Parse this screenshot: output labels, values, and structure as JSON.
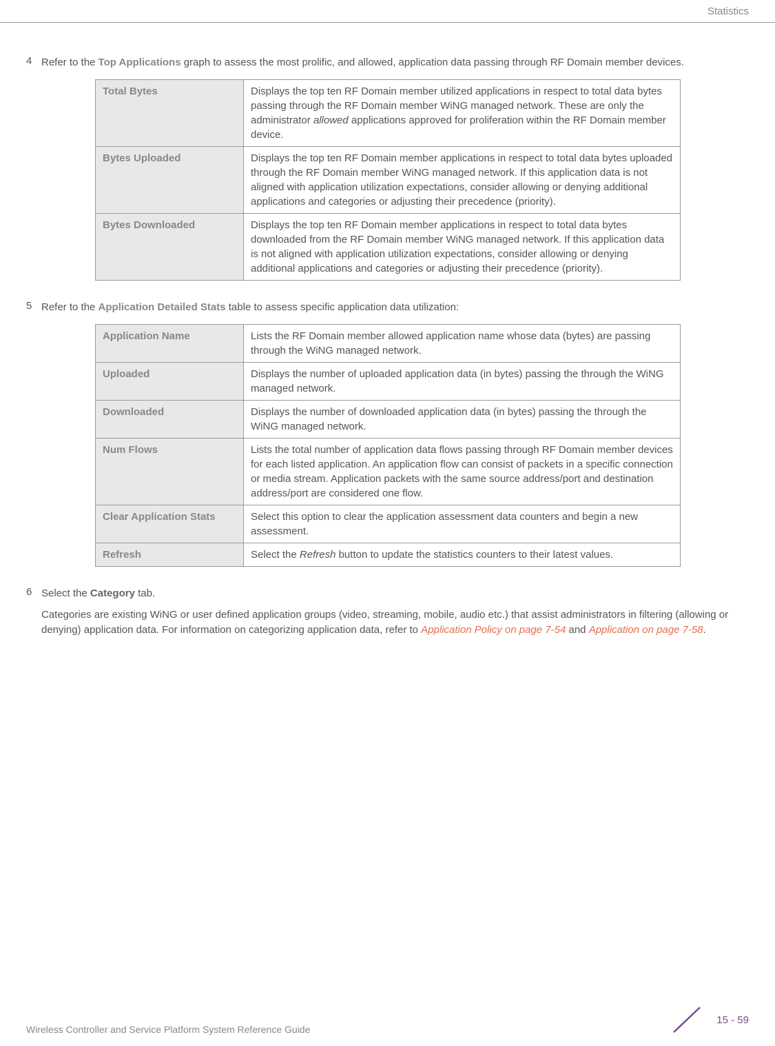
{
  "header": {
    "section": "Statistics"
  },
  "steps": {
    "s4": {
      "num": "4",
      "pre": "Refer to the ",
      "bold": "Top Applications",
      "post": " graph to assess the most prolific, and allowed, application data passing through RF Domain member devices."
    },
    "s5": {
      "num": "5",
      "pre": "Refer to the ",
      "bold": "Application Detailed Stats",
      "post": " table to assess specific application data utilization:"
    },
    "s6": {
      "num": "6",
      "pre": "Select the ",
      "bold": "Category",
      "post": " tab.",
      "para_pre": "Categories are existing WiNG or user defined application groups (video, streaming, mobile, audio etc.) that assist administrators in filtering (allowing or denying) application data. For information on categorizing application data, refer to ",
      "link1": "Application Policy on page 7-54",
      "mid": " and ",
      "link2": "Application on page 7-58",
      "end": "."
    }
  },
  "table1": {
    "r1": {
      "label": "Total Bytes",
      "desc_pre": "Displays the top ten RF Domain member utilized applications in respect to total data bytes passing through the RF Domain member WiNG managed network. These are only the administrator ",
      "desc_em": "allowed",
      "desc_post": " applications approved for proliferation within the RF Domain member device."
    },
    "r2": {
      "label": "Bytes Uploaded",
      "desc": "Displays the top ten RF Domain member applications in respect to total data bytes uploaded through the RF Domain member WiNG managed network. If this application data is not aligned with application utilization expectations, consider allowing or denying additional applications and categories or adjusting their precedence (priority)."
    },
    "r3": {
      "label": "Bytes Downloaded",
      "desc": "Displays the top ten RF Domain member applications in respect to total data bytes downloaded from the RF Domain member WiNG managed network. If this application data is not aligned with application utilization expectations, consider allowing or denying additional applications and categories or adjusting their precedence (priority)."
    }
  },
  "table2": {
    "r1": {
      "label": "Application Name",
      "desc": "Lists the RF Domain member allowed application name whose data (bytes) are passing through the WiNG managed network."
    },
    "r2": {
      "label": "Uploaded",
      "desc": "Displays the number of uploaded application data (in bytes) passing the through the WiNG managed network."
    },
    "r3": {
      "label": "Downloaded",
      "desc": "Displays the number of downloaded application data (in bytes) passing the through the WiNG managed network."
    },
    "r4": {
      "label": "Num Flows",
      "desc": "Lists the total number of application data flows passing through RF Domain member devices for each listed application. An application flow can consist of packets in a specific connection or media stream. Application packets with the same source address/port and destination address/port are considered one flow."
    },
    "r5": {
      "label": "Clear Application Stats",
      "desc": "Select this option to clear the application assessment data counters and begin a new assessment."
    },
    "r6": {
      "label": "Refresh",
      "desc_pre": "Select the ",
      "desc_em": "Refresh",
      "desc_post": " button to update the statistics counters to their latest values."
    }
  },
  "footer": {
    "text": "Wireless Controller and Service Platform System Reference Guide",
    "page": "15 - 59"
  }
}
